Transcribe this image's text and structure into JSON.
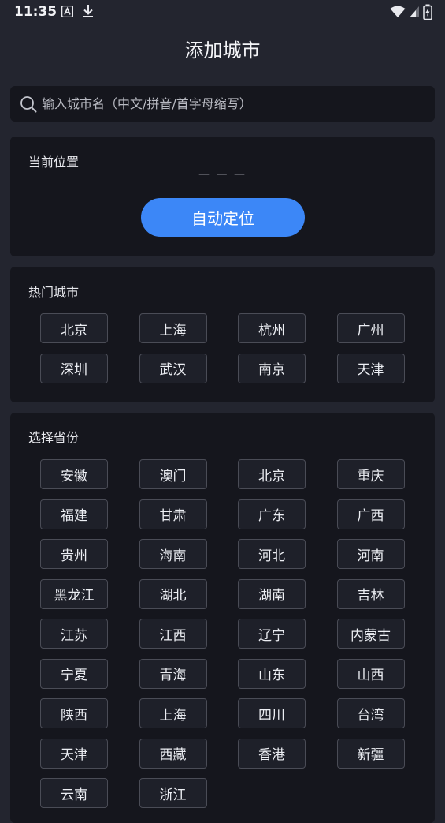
{
  "status_bar": {
    "time": "11:35",
    "icons": [
      "a-badge-icon",
      "download-icon",
      "wifi-icon",
      "signal-icon",
      "battery-charging-icon"
    ]
  },
  "header": {
    "title": "添加城市"
  },
  "search": {
    "placeholder": "输入城市名（中文/拼音/首字母缩写）",
    "value": ""
  },
  "current_location": {
    "title": "当前位置",
    "value": "— — —",
    "button_label": "自动定位",
    "button_color": "#3c87f7"
  },
  "hot_cities": {
    "title": "热门城市",
    "items": [
      "北京",
      "上海",
      "杭州",
      "广州",
      "深圳",
      "武汉",
      "南京",
      "天津"
    ]
  },
  "provinces": {
    "title": "选择省份",
    "items": [
      "安徽",
      "澳门",
      "北京",
      "重庆",
      "福建",
      "甘肃",
      "广东",
      "广西",
      "贵州",
      "海南",
      "河北",
      "河南",
      "黑龙江",
      "湖北",
      "湖南",
      "吉林",
      "江苏",
      "江西",
      "辽宁",
      "内蒙古",
      "宁夏",
      "青海",
      "山东",
      "山西",
      "陕西",
      "上海",
      "四川",
      "台湾",
      "天津",
      "西藏",
      "香港",
      "新疆",
      "云南",
      "浙江"
    ]
  }
}
